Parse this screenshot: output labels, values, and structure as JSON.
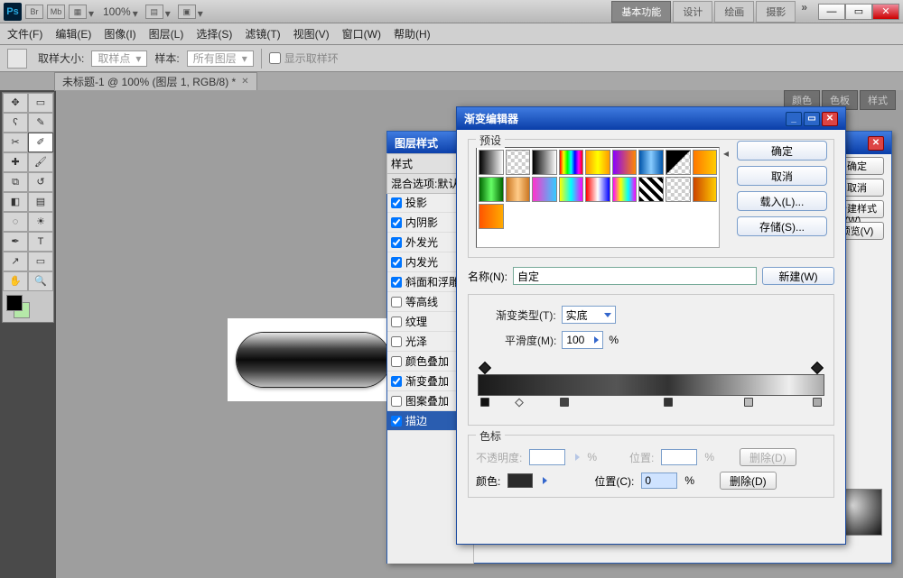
{
  "topbar": {
    "ps": "Ps",
    "br": "Br",
    "mb": "Mb",
    "zoom": "100%",
    "workspaces": [
      "基本功能",
      "设计",
      "绘画",
      "摄影"
    ],
    "chevrons": "»"
  },
  "menu": [
    "文件(F)",
    "编辑(E)",
    "图像(I)",
    "图层(L)",
    "选择(S)",
    "滤镜(T)",
    "视图(V)",
    "窗口(W)",
    "帮助(H)"
  ],
  "optbar": {
    "lbl_sample_size": "取样大小:",
    "val_sample_size": "取样点",
    "lbl_sample": "样本:",
    "val_sample": "所有图层",
    "cb_ring": "显示取样环"
  },
  "doctab": "未标题-1 @ 100% (图层 1, RGB/8) *",
  "right_tabs": [
    "颜色",
    "色板",
    "样式"
  ],
  "layerstyle": {
    "title": "图层样式",
    "styles_hdr": "样式",
    "blend_hdr": "混合选项:默认",
    "items": [
      {
        "label": "投影",
        "checked": true
      },
      {
        "label": "内阴影",
        "checked": true
      },
      {
        "label": "外发光",
        "checked": true
      },
      {
        "label": "内发光",
        "checked": true
      },
      {
        "label": "斜面和浮雕",
        "checked": true
      },
      {
        "label": "等高线",
        "checked": false
      },
      {
        "label": "纹理",
        "checked": false
      },
      {
        "label": "光泽",
        "checked": false
      },
      {
        "label": "颜色叠加",
        "checked": false
      },
      {
        "label": "渐变叠加",
        "checked": true
      },
      {
        "label": "图案叠加",
        "checked": false
      },
      {
        "label": "描边",
        "checked": true
      }
    ],
    "sel_index": 11,
    "btns": {
      "ok": "确定",
      "cancel": "取消",
      "new": "新建样式(W)...",
      "preview": "预览(V)"
    }
  },
  "grad": {
    "title": "渐变编辑器",
    "presets_lbl": "预设",
    "btn_ok": "确定",
    "btn_cancel": "取消",
    "btn_load": "载入(L)...",
    "btn_save": "存储(S)...",
    "name_lbl": "名称(N):",
    "name_val": "自定",
    "btn_new": "新建(W)",
    "type_lbl": "渐变类型(T):",
    "type_val": "实底",
    "smooth_lbl": "平滑度(M):",
    "smooth_val": "100",
    "pct": "%",
    "stops_lbl": "色标",
    "opacity_lbl": "不透明度:",
    "loc_lbl": "位置:",
    "loc2_lbl": "位置(C):",
    "loc2_val": "0",
    "color_lbl": "颜色:",
    "del_lbl": "删除(D)"
  }
}
